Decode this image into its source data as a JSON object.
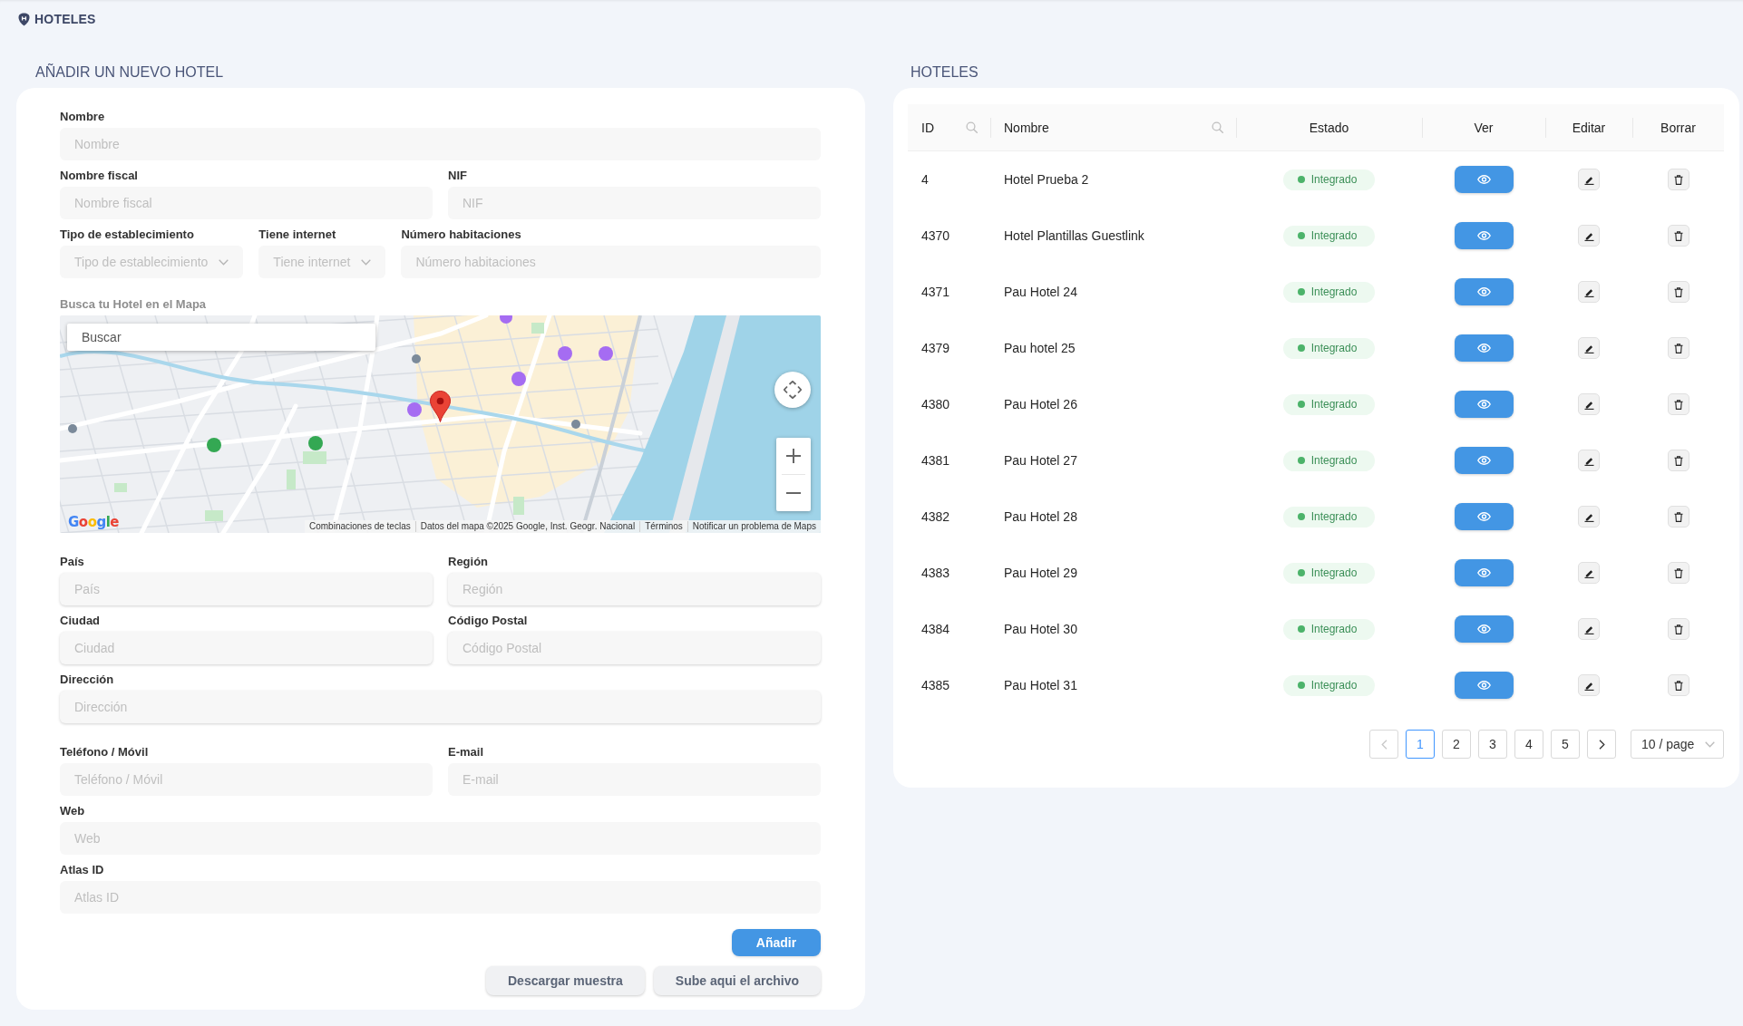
{
  "header": {
    "title": "HOTELES"
  },
  "form": {
    "title": "AÑADIR UN NUEVO HOTEL",
    "top_rows": [
      [
        {
          "kind": "input",
          "label": "Nombre",
          "placeholder": "Nombre"
        }
      ],
      [
        {
          "kind": "input",
          "label": "Nombre fiscal",
          "placeholder": "Nombre fiscal"
        },
        {
          "kind": "input",
          "label": "NIF",
          "placeholder": "NIF"
        }
      ],
      [
        {
          "kind": "select",
          "label": "Tipo de establecimiento",
          "placeholder": "Tipo de establecimiento"
        },
        {
          "kind": "select",
          "label": "Tiene internet",
          "placeholder": "Tiene internet"
        },
        {
          "kind": "input",
          "label": "Número habitaciones",
          "placeholder": "Número habitaciones"
        }
      ]
    ],
    "map": {
      "label": "Busca tu Hotel en el Mapa",
      "search_placeholder": "Buscar",
      "logo": "Google",
      "attribution": [
        "Combinaciones de teclas",
        "Datos del mapa ©2025 Google, Inst. Geogr. Nacional",
        "Términos",
        "Notificar un problema de Maps"
      ]
    },
    "address_rows": [
      [
        {
          "kind": "input",
          "label": "País",
          "placeholder": "País"
        },
        {
          "kind": "input",
          "label": "Región",
          "placeholder": "Región"
        }
      ],
      [
        {
          "kind": "input",
          "label": "Ciudad",
          "placeholder": "Ciudad"
        },
        {
          "kind": "input",
          "label": "Código Postal",
          "placeholder": "Código Postal"
        }
      ],
      [
        {
          "kind": "input",
          "label": "Dirección",
          "placeholder": "Dirección"
        }
      ]
    ],
    "contact_rows": [
      [
        {
          "kind": "input",
          "label": "Teléfono / Móvil",
          "placeholder": "Teléfono / Móvil"
        },
        {
          "kind": "input",
          "label": "E-mail",
          "placeholder": "E-mail"
        }
      ],
      [
        {
          "kind": "input",
          "label": "Web",
          "placeholder": "Web"
        }
      ],
      [
        {
          "kind": "input",
          "label": "Atlas ID",
          "placeholder": "Atlas ID"
        }
      ]
    ],
    "submit_button": "Añadir",
    "file_buttons": [
      "Descargar muestra",
      "Sube aqui el archivo"
    ]
  },
  "hotels": {
    "title": "HOTELES",
    "columns": [
      {
        "label": "ID",
        "kind": "text",
        "searchable": true
      },
      {
        "label": "Nombre",
        "kind": "text",
        "searchable": true
      },
      {
        "label": "Estado",
        "kind": "status",
        "searchable": false
      },
      {
        "label": "Ver",
        "kind": "view",
        "searchable": false
      },
      {
        "label": "Editar",
        "kind": "edit",
        "searchable": false
      },
      {
        "label": "Borrar",
        "kind": "delete",
        "searchable": false
      }
    ],
    "rows": [
      {
        "cells": [
          "4",
          "Hotel Prueba 2"
        ],
        "status": {
          "label": "Integrado",
          "color": "#4cb36a"
        }
      },
      {
        "cells": [
          "4370",
          "Hotel Plantillas Guestlink"
        ],
        "status": {
          "label": "Integrado",
          "color": "#4cb36a"
        }
      },
      {
        "cells": [
          "4371",
          "Pau Hotel 24"
        ],
        "status": {
          "label": "Integrado",
          "color": "#4cb36a"
        }
      },
      {
        "cells": [
          "4379",
          "Pau hotel 25"
        ],
        "status": {
          "label": "Integrado",
          "color": "#4cb36a"
        }
      },
      {
        "cells": [
          "4380",
          "Pau Hotel 26"
        ],
        "status": {
          "label": "Integrado",
          "color": "#4cb36a"
        }
      },
      {
        "cells": [
          "4381",
          "Pau Hotel 27"
        ],
        "status": {
          "label": "Integrado",
          "color": "#4cb36a"
        }
      },
      {
        "cells": [
          "4382",
          "Pau Hotel 28"
        ],
        "status": {
          "label": "Integrado",
          "color": "#4cb36a"
        }
      },
      {
        "cells": [
          "4383",
          "Pau Hotel 29"
        ],
        "status": {
          "label": "Integrado",
          "color": "#4cb36a"
        }
      },
      {
        "cells": [
          "4384",
          "Pau Hotel 30"
        ],
        "status": {
          "label": "Integrado",
          "color": "#4cb36a"
        }
      },
      {
        "cells": [
          "4385",
          "Pau Hotel 31"
        ],
        "status": {
          "label": "Integrado",
          "color": "#4cb36a"
        }
      }
    ],
    "pagination": {
      "previous": {
        "disabled": true
      },
      "pages": [
        {
          "label": "1",
          "selected": true
        },
        {
          "label": "2",
          "selected": false
        },
        {
          "label": "3",
          "selected": false
        },
        {
          "label": "4",
          "selected": false
        },
        {
          "label": "5",
          "selected": false
        }
      ],
      "next": {
        "disabled": false
      },
      "page_size": "10 / page"
    }
  }
}
